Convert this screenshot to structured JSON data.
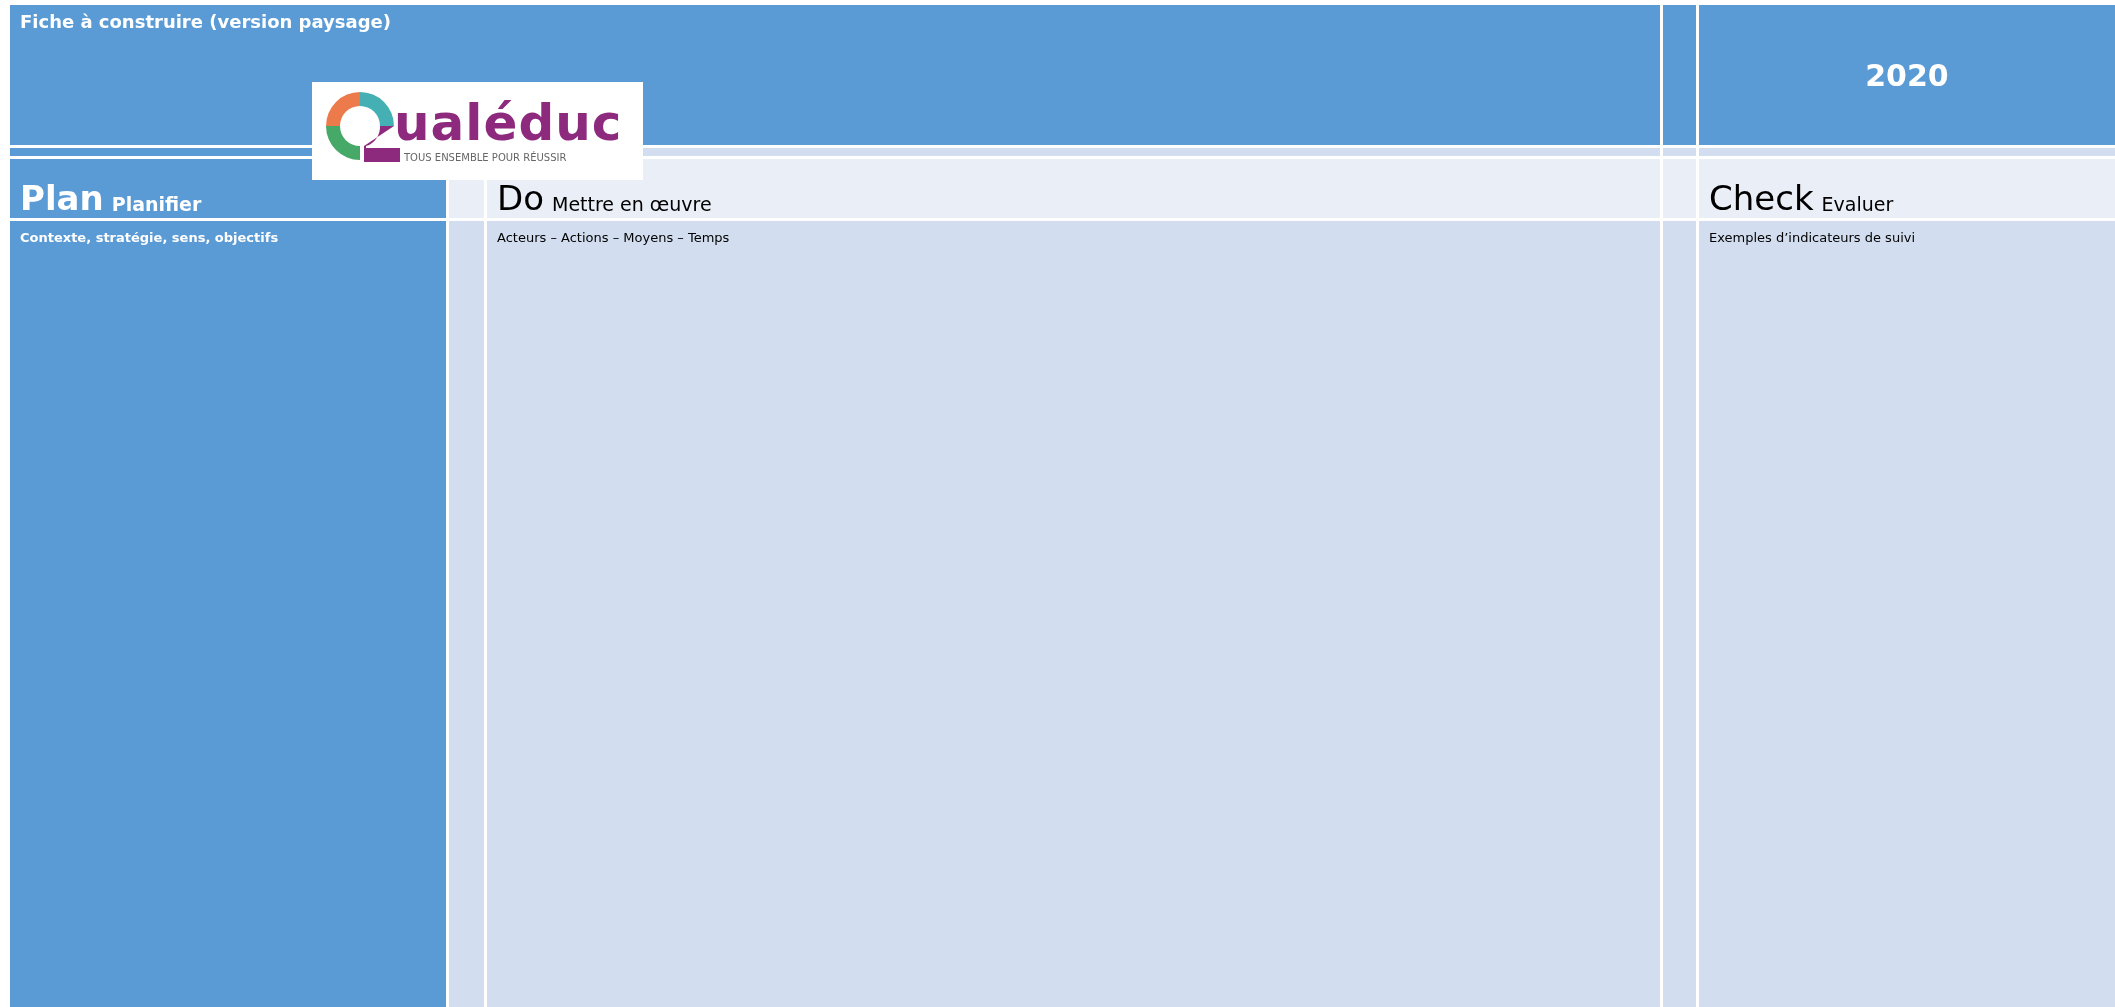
{
  "header": {
    "title": "Fiche à construire (version paysage)",
    "year": "2020"
  },
  "logo": {
    "wordmark": "ualéduc",
    "tagline": "TOUS ENSEMBLE POUR RÉUSSIR"
  },
  "sections": [
    {
      "kind": "primary",
      "heading": "Plan",
      "subheading": "Planifier",
      "description": "Contexte, stratégie, sens, objectifs"
    },
    {
      "kind": "light",
      "heading": "Do",
      "subheading": "Mettre en œuvre",
      "description": "Acteurs – Actions – Moyens – Temps"
    },
    {
      "kind": "light",
      "heading": "Check",
      "subheading": "Evaluer",
      "description": "Exemples d’indicateurs de suivi"
    }
  ]
}
